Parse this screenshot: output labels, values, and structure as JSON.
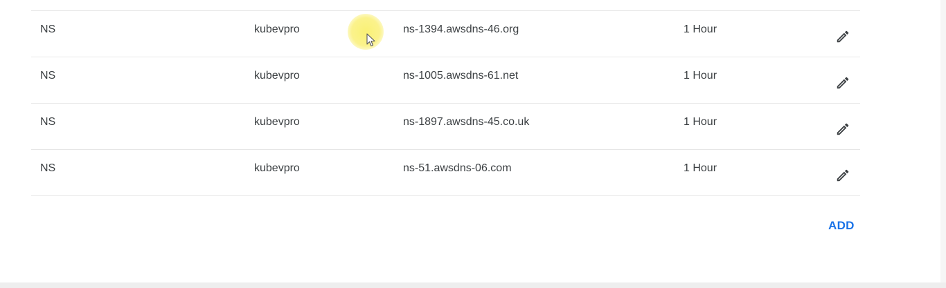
{
  "records": [
    {
      "type": "NS",
      "host": "kubevpro",
      "data": "ns-1394.awsdns-46.org",
      "ttl": "1 Hour",
      "edit_icon": "pencil-icon"
    },
    {
      "type": "NS",
      "host": "kubevpro",
      "data": "ns-1005.awsdns-61.net",
      "ttl": "1 Hour",
      "edit_icon": "pencil-icon"
    },
    {
      "type": "NS",
      "host": "kubevpro",
      "data": "ns-1897.awsdns-45.co.uk",
      "ttl": "1 Hour",
      "edit_icon": "pencil-icon"
    },
    {
      "type": "NS",
      "host": "kubevpro",
      "data": "ns-51.awsdns-06.com",
      "ttl": "1 Hour",
      "edit_icon": "pencil-icon"
    }
  ],
  "actions": {
    "add_label": "ADD"
  },
  "colors": {
    "accent": "#1a73e8",
    "text": "#3c4043",
    "divider": "#e6e6e6",
    "cursor_highlight": "#f7ee6a"
  }
}
